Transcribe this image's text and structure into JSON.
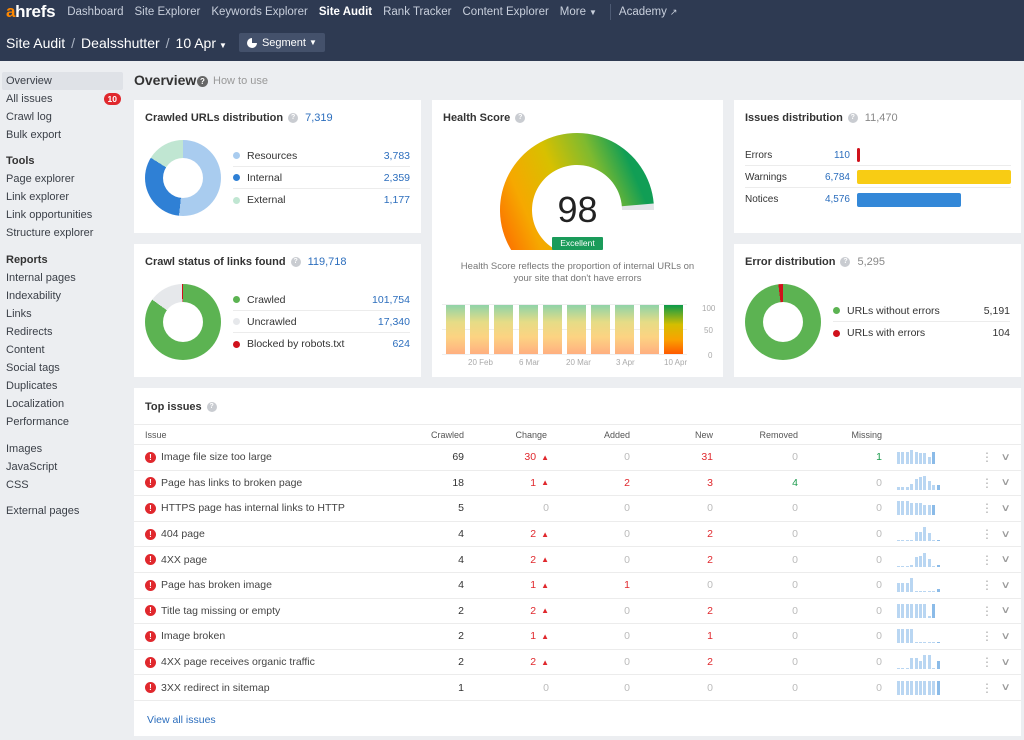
{
  "topnav": {
    "logo_a": "a",
    "logo_rest": "hrefs",
    "items": [
      {
        "label": "Dashboard",
        "active": false
      },
      {
        "label": "Site Explorer",
        "active": false
      },
      {
        "label": "Keywords Explorer",
        "active": false
      },
      {
        "label": "Site Audit",
        "active": true
      },
      {
        "label": "Rank Tracker",
        "active": false
      },
      {
        "label": "Content Explorer",
        "active": false
      }
    ],
    "more_label": "More",
    "academy_label": "Academy"
  },
  "breadcrumb": {
    "root": "Site Audit",
    "project": "Dealsshutter",
    "date": "10 Apr",
    "segment_label": "Segment"
  },
  "sidebar": {
    "items": [
      {
        "label": "Overview",
        "active": true
      },
      {
        "label": "All issues",
        "badge": "10"
      },
      {
        "label": "Crawl log"
      },
      {
        "label": "Bulk export"
      }
    ],
    "tools_heading": "Tools",
    "tools": [
      "Page explorer",
      "Link explorer",
      "Link opportunities",
      "Structure explorer"
    ],
    "reports_heading": "Reports",
    "reports": [
      "Internal pages",
      "Indexability",
      "Links",
      "Redirects",
      "Content",
      "Social tags",
      "Duplicates",
      "Localization",
      "Performance"
    ],
    "resources": [
      "Images",
      "JavaScript",
      "CSS"
    ],
    "external": [
      "External pages"
    ]
  },
  "overview": {
    "title": "Overview",
    "how_to_use": "How to use"
  },
  "crawled_urls": {
    "title": "Crawled URLs distribution",
    "total": "7,319",
    "items": [
      {
        "label": "Resources",
        "value": "3,783",
        "num": 3783,
        "color": "#a9ccef"
      },
      {
        "label": "Internal",
        "value": "2,359",
        "num": 2359,
        "color": "#2f80d5"
      },
      {
        "label": "External",
        "value": "1,177",
        "num": 1177,
        "color": "#c0e6d2"
      }
    ]
  },
  "crawl_status": {
    "title": "Crawl status of links found",
    "total": "119,718",
    "items": [
      {
        "label": "Crawled",
        "value": "101,754",
        "num": 101754,
        "color": "#5cb352"
      },
      {
        "label": "Uncrawled",
        "value": "17,340",
        "num": 17340,
        "color": "#e6e8eb"
      },
      {
        "label": "Blocked by robots.txt",
        "value": "624",
        "num": 624,
        "color": "#d0111b"
      }
    ]
  },
  "health": {
    "title": "Health Score",
    "score": "98",
    "score_value": 98,
    "rating": "Excellent",
    "description": "Health Score reflects the proportion of internal URLs on your site that don't have errors",
    "history_values": [
      98,
      98,
      98,
      98,
      98,
      98,
      98,
      98,
      98,
      98
    ],
    "y_ticks": [
      "100",
      "50",
      "0"
    ],
    "x_ticks": [
      "20 Feb",
      "6 Mar",
      "20 Mar",
      "3 Apr",
      "10 Apr"
    ]
  },
  "issues_distribution": {
    "title": "Issues distribution",
    "total": "11,470",
    "items": [
      {
        "label": "Errors",
        "value": "110",
        "num": 110,
        "color": "#d0111b"
      },
      {
        "label": "Warnings",
        "value": "6,784",
        "num": 6784,
        "color": "#f8cc14"
      },
      {
        "label": "Notices",
        "value": "4,576",
        "num": 4576,
        "color": "#3388d8"
      }
    ]
  },
  "error_distribution": {
    "title": "Error distribution",
    "total": "5,295",
    "items": [
      {
        "label": "URLs without errors",
        "value": "5,191",
        "num": 5191,
        "color": "#5cb352"
      },
      {
        "label": "URLs with errors",
        "value": "104",
        "num": 104,
        "color": "#d0111b"
      }
    ]
  },
  "top_issues": {
    "title": "Top issues",
    "columns": [
      "Issue",
      "Crawled",
      "Change",
      "Added",
      "New",
      "Removed",
      "Missing"
    ],
    "rows": [
      {
        "issue": "Image file size too large",
        "crawled": "69",
        "change": "30",
        "change_up": true,
        "added": "0",
        "new": "31",
        "removed": "0",
        "missing": "1",
        "trend": [
          8,
          8,
          8,
          9,
          8,
          7,
          7,
          5,
          8
        ]
      },
      {
        "issue": "Page has links to broken page",
        "crawled": "18",
        "change": "1",
        "change_up": true,
        "added": "2",
        "new": "3",
        "removed": "4",
        "missing": "0",
        "trend": [
          2,
          2,
          2,
          4,
          7,
          8,
          9,
          6,
          3,
          3
        ]
      },
      {
        "issue": "HTTPS page has internal links to HTTP",
        "crawled": "5",
        "change": "0",
        "change_up": false,
        "added": "0",
        "new": "0",
        "removed": "0",
        "missing": "0",
        "trend": [
          9,
          9,
          9,
          8,
          8,
          8,
          7,
          7,
          7
        ]
      },
      {
        "issue": "404 page",
        "crawled": "4",
        "change": "2",
        "change_up": true,
        "added": "0",
        "new": "2",
        "removed": "0",
        "missing": "0",
        "trend": [
          0,
          0,
          0,
          1,
          6,
          6,
          9,
          5,
          0,
          1
        ]
      },
      {
        "issue": "4XX page",
        "crawled": "4",
        "change": "2",
        "change_up": true,
        "added": "0",
        "new": "2",
        "removed": "0",
        "missing": "0",
        "trend": [
          0,
          0,
          0,
          1,
          6,
          7,
          9,
          5,
          0,
          1
        ]
      },
      {
        "issue": "Page has broken image",
        "crawled": "4",
        "change": "1",
        "change_up": true,
        "added": "1",
        "new": "0",
        "removed": "0",
        "missing": "0",
        "trend": [
          6,
          6,
          6,
          9,
          1,
          1,
          1,
          1,
          1,
          2
        ]
      },
      {
        "issue": "Title tag missing or empty",
        "crawled": "2",
        "change": "2",
        "change_up": true,
        "added": "0",
        "new": "2",
        "removed": "0",
        "missing": "0",
        "trend": [
          9,
          9,
          9,
          9,
          9,
          9,
          9,
          1,
          9
        ]
      },
      {
        "issue": "Image broken",
        "crawled": "2",
        "change": "1",
        "change_up": true,
        "added": "0",
        "new": "1",
        "removed": "0",
        "missing": "0",
        "trend": [
          9,
          9,
          9,
          9,
          0,
          0,
          0,
          0,
          0,
          0
        ]
      },
      {
        "issue": "4XX page receives organic traffic",
        "crawled": "2",
        "change": "2",
        "change_up": true,
        "added": "0",
        "new": "2",
        "removed": "0",
        "missing": "0",
        "trend": [
          0,
          0,
          0,
          7,
          7,
          5,
          9,
          9,
          1,
          5
        ]
      },
      {
        "issue": "3XX redirect in sitemap",
        "crawled": "1",
        "change": "0",
        "change_up": false,
        "added": "0",
        "new": "0",
        "removed": "0",
        "missing": "0",
        "trend": [
          9,
          9,
          9,
          9,
          9,
          9,
          9,
          9,
          9,
          9
        ]
      }
    ],
    "view_all": "View all issues"
  }
}
